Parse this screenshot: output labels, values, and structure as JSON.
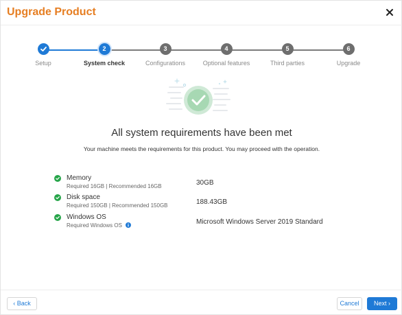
{
  "dialog": {
    "title": "Upgrade Product",
    "close_icon": "close-icon"
  },
  "stepper": {
    "steps": [
      {
        "number": "1",
        "label": "Setup",
        "state": "done"
      },
      {
        "number": "2",
        "label": "System check",
        "state": "active"
      },
      {
        "number": "3",
        "label": "Configurations",
        "state": "pending"
      },
      {
        "number": "4",
        "label": "Optional features",
        "state": "pending"
      },
      {
        "number": "5",
        "label": "Third parties",
        "state": "pending"
      },
      {
        "number": "6",
        "label": "Upgrade",
        "state": "pending"
      }
    ]
  },
  "main": {
    "illustration_icon": "success-check-illustration",
    "headline": "All system requirements have been met",
    "subline": "Your machine meets the requirements for this product. You may proceed with the operation.",
    "requirements": [
      {
        "name": "Memory",
        "requirement": "Required 16GB | Recommended 16GB",
        "value": "30GB",
        "icon": "check-circle-icon"
      },
      {
        "name": "Disk space",
        "requirement": "Required 150GB | Recommended 150GB",
        "value": "188.43GB",
        "icon": "check-circle-icon"
      },
      {
        "name": "Windows OS",
        "requirement": "Required Windows OS",
        "value": "Microsoft Windows Server 2019 Standard",
        "icon": "check-circle-icon",
        "info_icon": "info-icon"
      }
    ]
  },
  "footer": {
    "back_label": "Back",
    "cancel_label": "Cancel",
    "next_label": "Next"
  },
  "colors": {
    "title": "#e67e22",
    "accent": "#1f7ad6",
    "success": "#27a54a",
    "step_pending": "#6e6e6e"
  }
}
